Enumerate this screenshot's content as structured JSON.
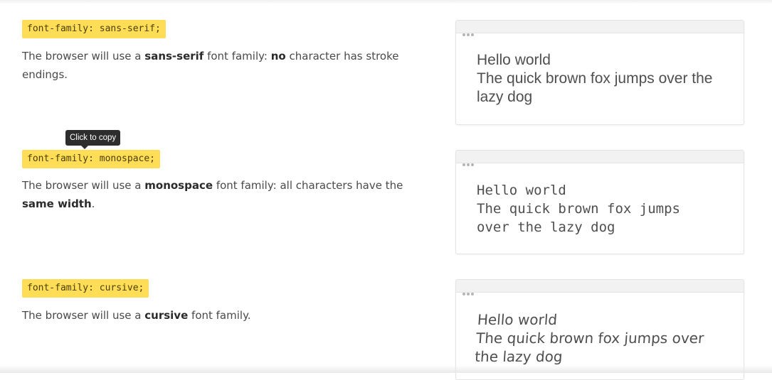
{
  "tooltip": "Click to copy",
  "sections": [
    {
      "code": "font-family: sans-serif;",
      "desc": {
        "p1": "The browser will use a ",
        "b1": "sans-serif",
        "p2": " font family: ",
        "b2": "no",
        "p3": " character has stroke endings."
      },
      "demo": [
        "Hello world",
        "The quick brown fox jumps over the",
        "lazy dog"
      ]
    },
    {
      "code": "font-family: monospace;",
      "desc": {
        "p1": "The browser will use a ",
        "b1": "monospace",
        "p2": " font family: all characters have the ",
        "b2": "same width",
        "p3": "."
      },
      "demo": [
        "Hello world",
        "The quick brown fox jumps",
        "over the lazy dog"
      ]
    },
    {
      "code": "font-family: cursive;",
      "desc": {
        "p1": "The browser will use a ",
        "b1": "cursive",
        "p2": " font family."
      },
      "demo": [
        "Hello world",
        "The quick brown fox jumps over",
        "the lazy dog"
      ]
    }
  ]
}
